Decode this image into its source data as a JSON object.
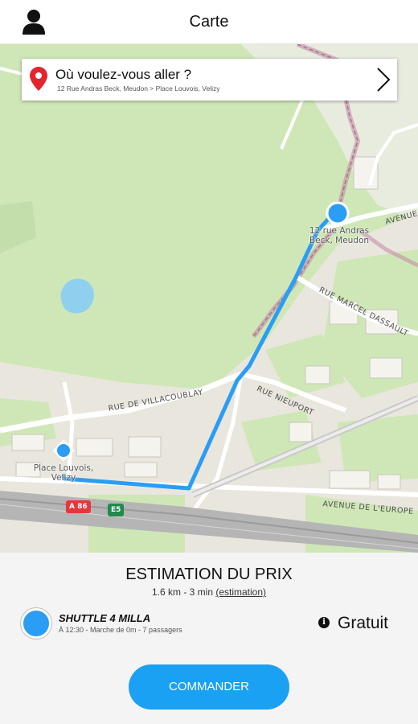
{
  "header": {
    "title": "Carte",
    "profile_icon": "user-icon"
  },
  "search": {
    "question": "Où voulez-vous aller ?",
    "route": "12 Rue Andras Beck, Meudon > Place Louvois, Velizy",
    "pin_icon": "location-pin-icon",
    "chevron_icon": "chevron-right-icon"
  },
  "map": {
    "roads": {
      "villacoublay": "RUE DE VILLACOUBLAY",
      "nieuport": "RUE NIEUPORT",
      "marcel_dassault": "RUE MARCEL DASSAULT",
      "avenue_top": "AVENUE",
      "europe": "AVENUE DE L'EUROPE"
    },
    "shields": {
      "a86": "A 86",
      "e5": "E5"
    },
    "origin_label_1": "12 rue Andras",
    "origin_label_2": "Beck, Meudon",
    "dest_label_1": "Place Louvois,",
    "dest_label_2": "Velizy",
    "route_color": "#2a9df4"
  },
  "estimate": {
    "title": "ESTIMATION DU PRIX",
    "summary": "1.6 km - 3 min",
    "link": "(estimation)"
  },
  "shuttle": {
    "name": "SHUTTLE 4 MILLA",
    "info": "À 12:30 - Marche de 0m - 7 passagers",
    "price": "Gratuit",
    "info_icon": "info-icon",
    "color": "#2a9df4"
  },
  "order_button": {
    "label": "COMMANDER",
    "color": "#1aa1f4"
  }
}
